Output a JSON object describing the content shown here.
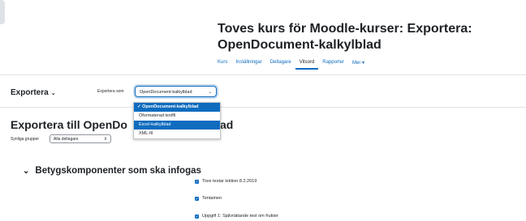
{
  "course": {
    "title": "Toves kurs för Moodle-kurser: Exportera: OpenDocument-kalkylblad"
  },
  "nav": {
    "tabs": [
      {
        "label": "Kurs"
      },
      {
        "label": "Inställningar"
      },
      {
        "label": "Deltagare"
      },
      {
        "label": "Vitsord"
      },
      {
        "label": "Rapporter"
      },
      {
        "label": "Mer ▾"
      }
    ],
    "active": "Vitsord"
  },
  "export": {
    "heading": "Exportera",
    "as_label": "Exportera som",
    "selected": "OpenDocument-kalkylblad",
    "options": [
      {
        "label": "✓ OpenDocument-kalkylblad"
      },
      {
        "label": "Oformaterad textfil"
      },
      {
        "label": "Excel-kalkylblad"
      },
      {
        "label": "XML-fil"
      }
    ]
  },
  "page": {
    "heading_part1": "Exportera till OpenDo",
    "heading_part2": "ad",
    "groups_label": "Synliga grupper",
    "groups_value": "Alla deltagare"
  },
  "components": {
    "heading": "Betygskomponenter som ska infogas",
    "items": [
      {
        "label": "Tove testar lektion 8.2.2019"
      },
      {
        "label": "Tentamen"
      },
      {
        "label": "Uppgift 1: Självrättande test om frukter"
      }
    ]
  },
  "colors": {
    "accent": "#0f6cbf"
  }
}
